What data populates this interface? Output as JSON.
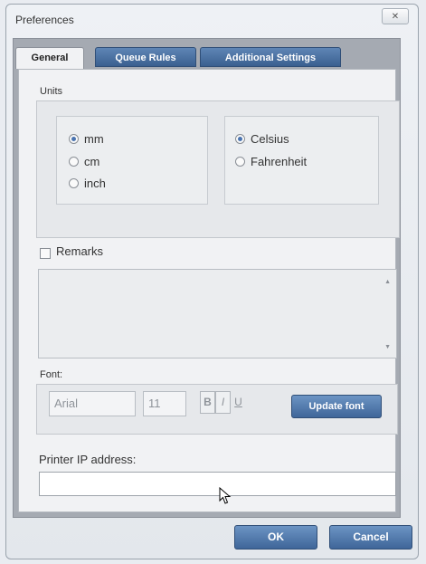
{
  "window": {
    "title": "Preferences",
    "close_glyph": "✕"
  },
  "tabs": [
    {
      "label": "General",
      "active": true
    },
    {
      "label": "Queue Rules",
      "active": false
    },
    {
      "label": "Additional Settings",
      "active": false
    }
  ],
  "units": {
    "label": "Units",
    "length_options": [
      {
        "label": "mm",
        "selected": true
      },
      {
        "label": "cm",
        "selected": false
      },
      {
        "label": "inch",
        "selected": false
      }
    ],
    "temperature_options": [
      {
        "label": "Celsius",
        "selected": true
      },
      {
        "label": "Fahrenheit",
        "selected": false
      }
    ]
  },
  "remarks": {
    "label": "Remarks",
    "checked": false,
    "text": ""
  },
  "font": {
    "label": "Font:",
    "family": "Arial",
    "size": "11",
    "bold_label": "B",
    "italic_label": "I",
    "underline_label": "U",
    "update_button": "Update font"
  },
  "printer_ip": {
    "label": "Printer IP address:",
    "value": ""
  },
  "buttons": {
    "ok": "OK",
    "cancel": "Cancel"
  },
  "colors": {
    "accent": "#4a74b0",
    "button": "#3f6699"
  },
  "icons": {
    "close": "close-icon",
    "pointer": "mouse-pointer-icon"
  }
}
